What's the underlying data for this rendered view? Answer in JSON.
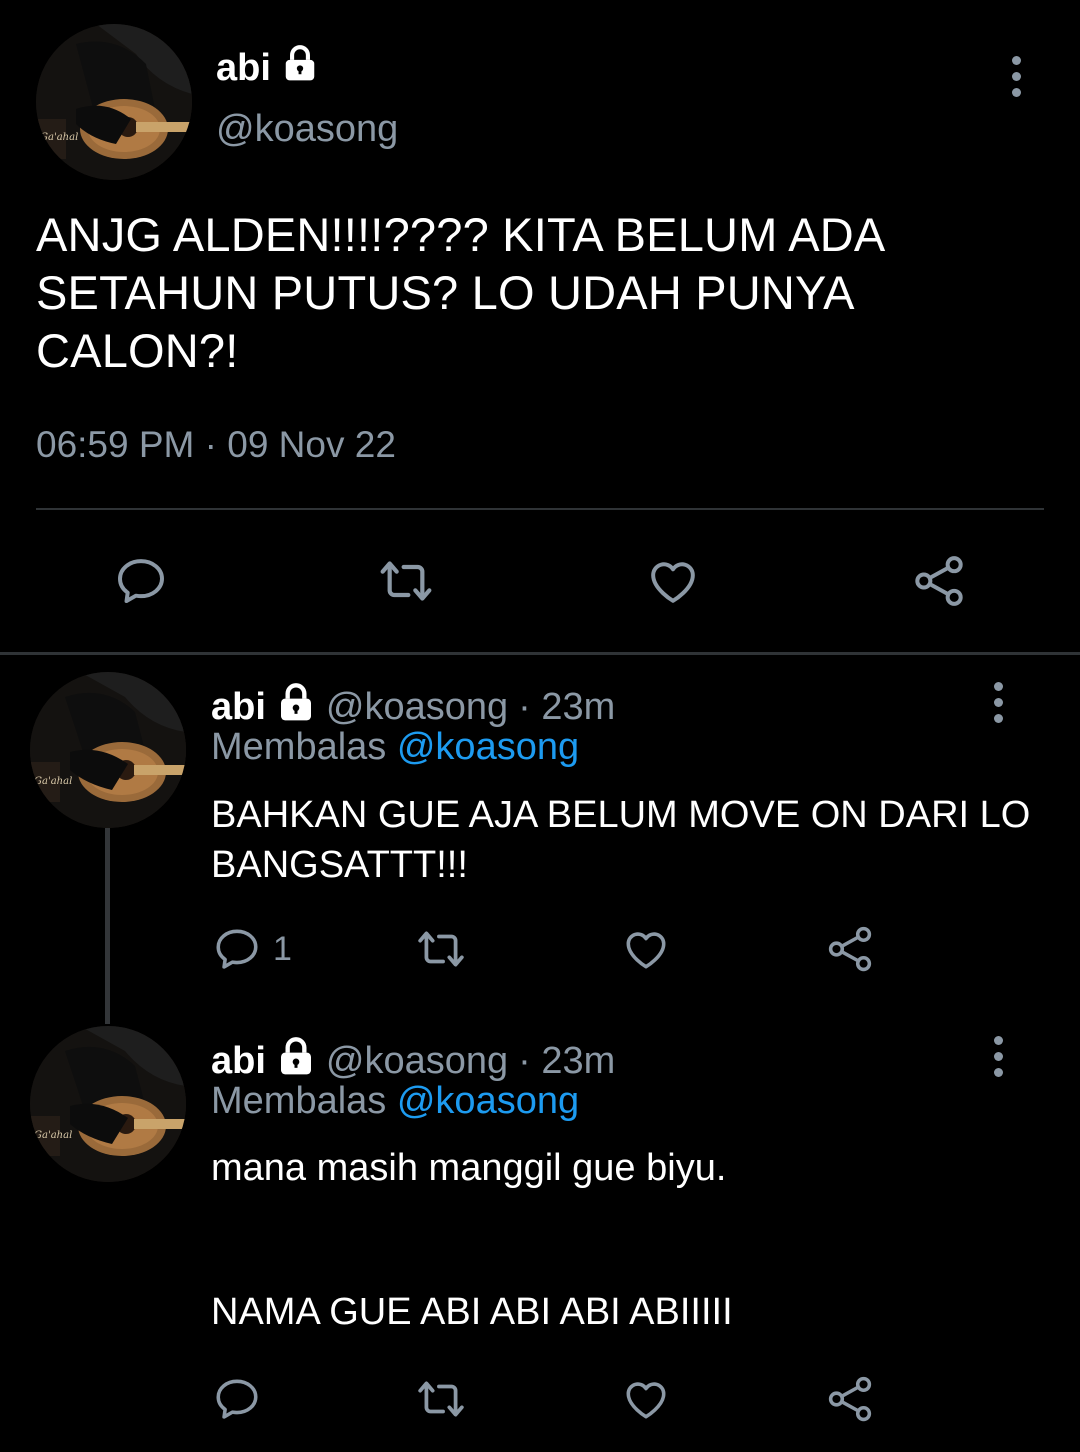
{
  "main_tweet": {
    "name": "abi",
    "handle": "@koasong",
    "text": "ANJG ALDEN!!!!???? KITA BELUM ADA SETAHUN PUTUS? LO UDAH PUNYA CALON?!",
    "timestamp": "06:59 PM · 09 Nov 22",
    "actions": {
      "reply": "reply-icon",
      "retweet": "retweet-icon",
      "like": "heart-icon",
      "share": "share-icon"
    }
  },
  "replies": [
    {
      "name": "abi",
      "handle": "@koasong",
      "time": "· 23m",
      "replying_prefix": "Membalas",
      "replying_to": "@koasong",
      "text": "BAHKAN GUE AJA BELUM MOVE ON DARI LO BANGSATTT!!!",
      "reply_count": "1"
    },
    {
      "name": "abi",
      "handle": "@koasong",
      "time": "· 23m",
      "replying_prefix": "Membalas",
      "replying_to": "@koasong",
      "text": "mana masih manggil gue biyu.\n\n\nNAMA GUE ABI ABI ABI ABIIIII",
      "reply_count": ""
    }
  ],
  "colors": {
    "background": "#000000",
    "text_primary": "#ffffff",
    "text_secondary": "#8b98a5",
    "accent": "#1d9bf0",
    "divider": "#2f3336"
  }
}
